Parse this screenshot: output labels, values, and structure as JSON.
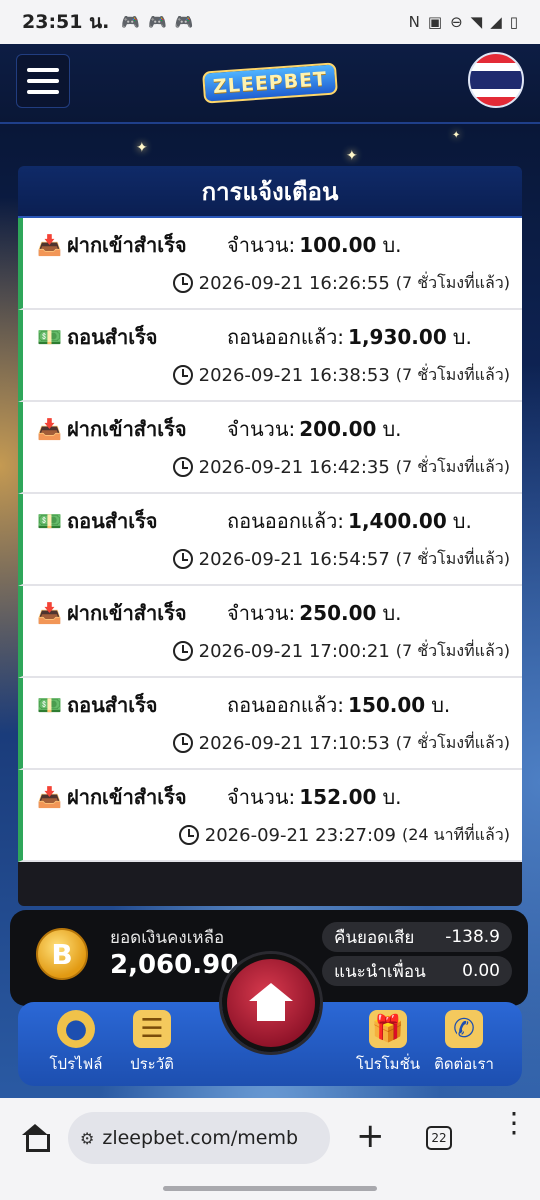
{
  "status_bar": {
    "time": "23:51 น.",
    "left_icons": [
      "gamepad-icon",
      "gamepad-icon",
      "gamepad-icon"
    ],
    "right_icons": [
      "nfc-icon",
      "volte-icon",
      "dnd-icon",
      "wifi-icon",
      "signal-icon",
      "battery-icon"
    ]
  },
  "header": {
    "logo_text": "ZLEEPBET",
    "menu_icon": "hamburger-icon",
    "flag": "thailand-flag"
  },
  "notifications": {
    "title": "การแจ้งเตือน",
    "currency": "บ.",
    "items": [
      {
        "type": "deposit",
        "icon": "📥",
        "label": "ฝากเข้าสำเร็จ",
        "amount_label": "จำนวน:",
        "amount": "100.00",
        "datetime": "2026-09-21 16:26:55",
        "ago": "(7 ชั่วโมงที่แล้ว)"
      },
      {
        "type": "withdraw",
        "icon": "💵",
        "label": "ถอนสำเร็จ",
        "amount_label": "ถอนออกแล้ว:",
        "amount": "1,930.00",
        "datetime": "2026-09-21 16:38:53",
        "ago": "(7 ชั่วโมงที่แล้ว)"
      },
      {
        "type": "deposit",
        "icon": "📥",
        "label": "ฝากเข้าสำเร็จ",
        "amount_label": "จำนวน:",
        "amount": "200.00",
        "datetime": "2026-09-21 16:42:35",
        "ago": "(7 ชั่วโมงที่แล้ว)"
      },
      {
        "type": "withdraw",
        "icon": "💵",
        "label": "ถอนสำเร็จ",
        "amount_label": "ถอนออกแล้ว:",
        "amount": "1,400.00",
        "datetime": "2026-09-21 16:54:57",
        "ago": "(7 ชั่วโมงที่แล้ว)"
      },
      {
        "type": "deposit",
        "icon": "📥",
        "label": "ฝากเข้าสำเร็จ",
        "amount_label": "จำนวน:",
        "amount": "250.00",
        "datetime": "2026-09-21 17:00:21",
        "ago": "(7 ชั่วโมงที่แล้ว)"
      },
      {
        "type": "withdraw",
        "icon": "💵",
        "label": "ถอนสำเร็จ",
        "amount_label": "ถอนออกแล้ว:",
        "amount": "150.00",
        "datetime": "2026-09-21 17:10:53",
        "ago": "(7 ชั่วโมงที่แล้ว)"
      },
      {
        "type": "deposit",
        "icon": "📥",
        "label": "ฝากเข้าสำเร็จ",
        "amount_label": "จำนวน:",
        "amount": "152.00",
        "datetime": "2026-09-21 23:27:09",
        "ago": "(24 นาทีที่แล้ว)"
      }
    ]
  },
  "balance": {
    "label": "ยอดเงินคงเหลือ",
    "value": "2,060.90",
    "coin_symbol": "B",
    "cashback_label": "คืนยอดเสีย",
    "cashback_value": "-138.9",
    "referral_label": "แนะนำเพื่อน",
    "referral_value": "0.00"
  },
  "bottom_nav": {
    "profile": "โปรไฟล์",
    "history": "ประวัติ",
    "promotion": "โปรโมชั่น",
    "contact": "ติดต่อเรา",
    "home_icon": "home-icon"
  },
  "browser": {
    "url": "zleepbet.com/memb",
    "tab_count": "22"
  },
  "colors": {
    "accent_green": "#2fa65a",
    "nav_blue": "#2b68d6",
    "home_red": "#c82a42"
  }
}
